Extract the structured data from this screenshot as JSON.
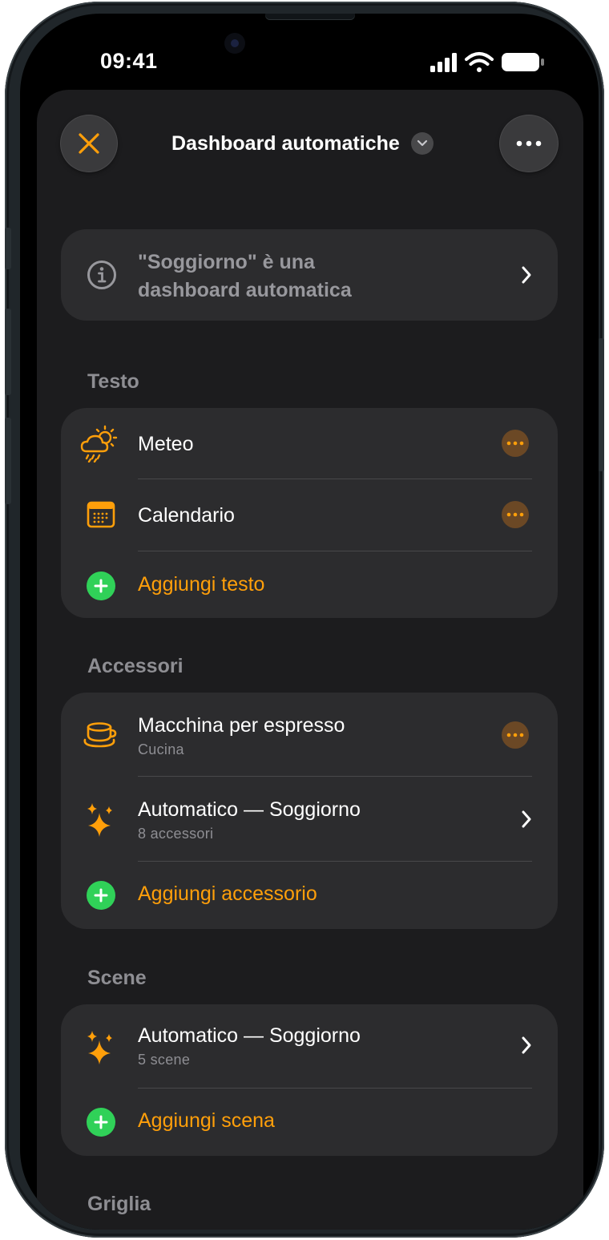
{
  "status_bar": {
    "time": "09:41"
  },
  "header": {
    "title": "Dashboard automatiche"
  },
  "info_banner": {
    "text_line1": "\"Soggiorno\" è una",
    "text_line2": "dashboard automatica"
  },
  "sections": {
    "testo": {
      "header": "Testo",
      "items": [
        {
          "title": "Meteo",
          "icon": "weather-icon"
        },
        {
          "title": "Calendario",
          "icon": "calendar-icon"
        }
      ],
      "add_label": "Aggiungi testo"
    },
    "accessori": {
      "header": "Accessori",
      "items": [
        {
          "title": "Macchina per espresso",
          "subtitle": "Cucina",
          "icon": "coffee-cup-icon"
        },
        {
          "title": "Automatico — Soggiorno",
          "subtitle": "8 accessori",
          "icon": "sparkles-icon"
        }
      ],
      "add_label": "Aggiungi accessorio"
    },
    "scene": {
      "header": "Scene",
      "items": [
        {
          "title": "Automatico — Soggiorno",
          "subtitle": "5 scene",
          "icon": "sparkles-icon"
        }
      ],
      "add_label": "Aggiungi scena"
    },
    "griglia": {
      "header": "Griglia"
    }
  },
  "colors": {
    "accent": "#ff9f0a",
    "add": "#30d158",
    "sheet": "#1c1c1e",
    "card": "#2c2c2e"
  }
}
